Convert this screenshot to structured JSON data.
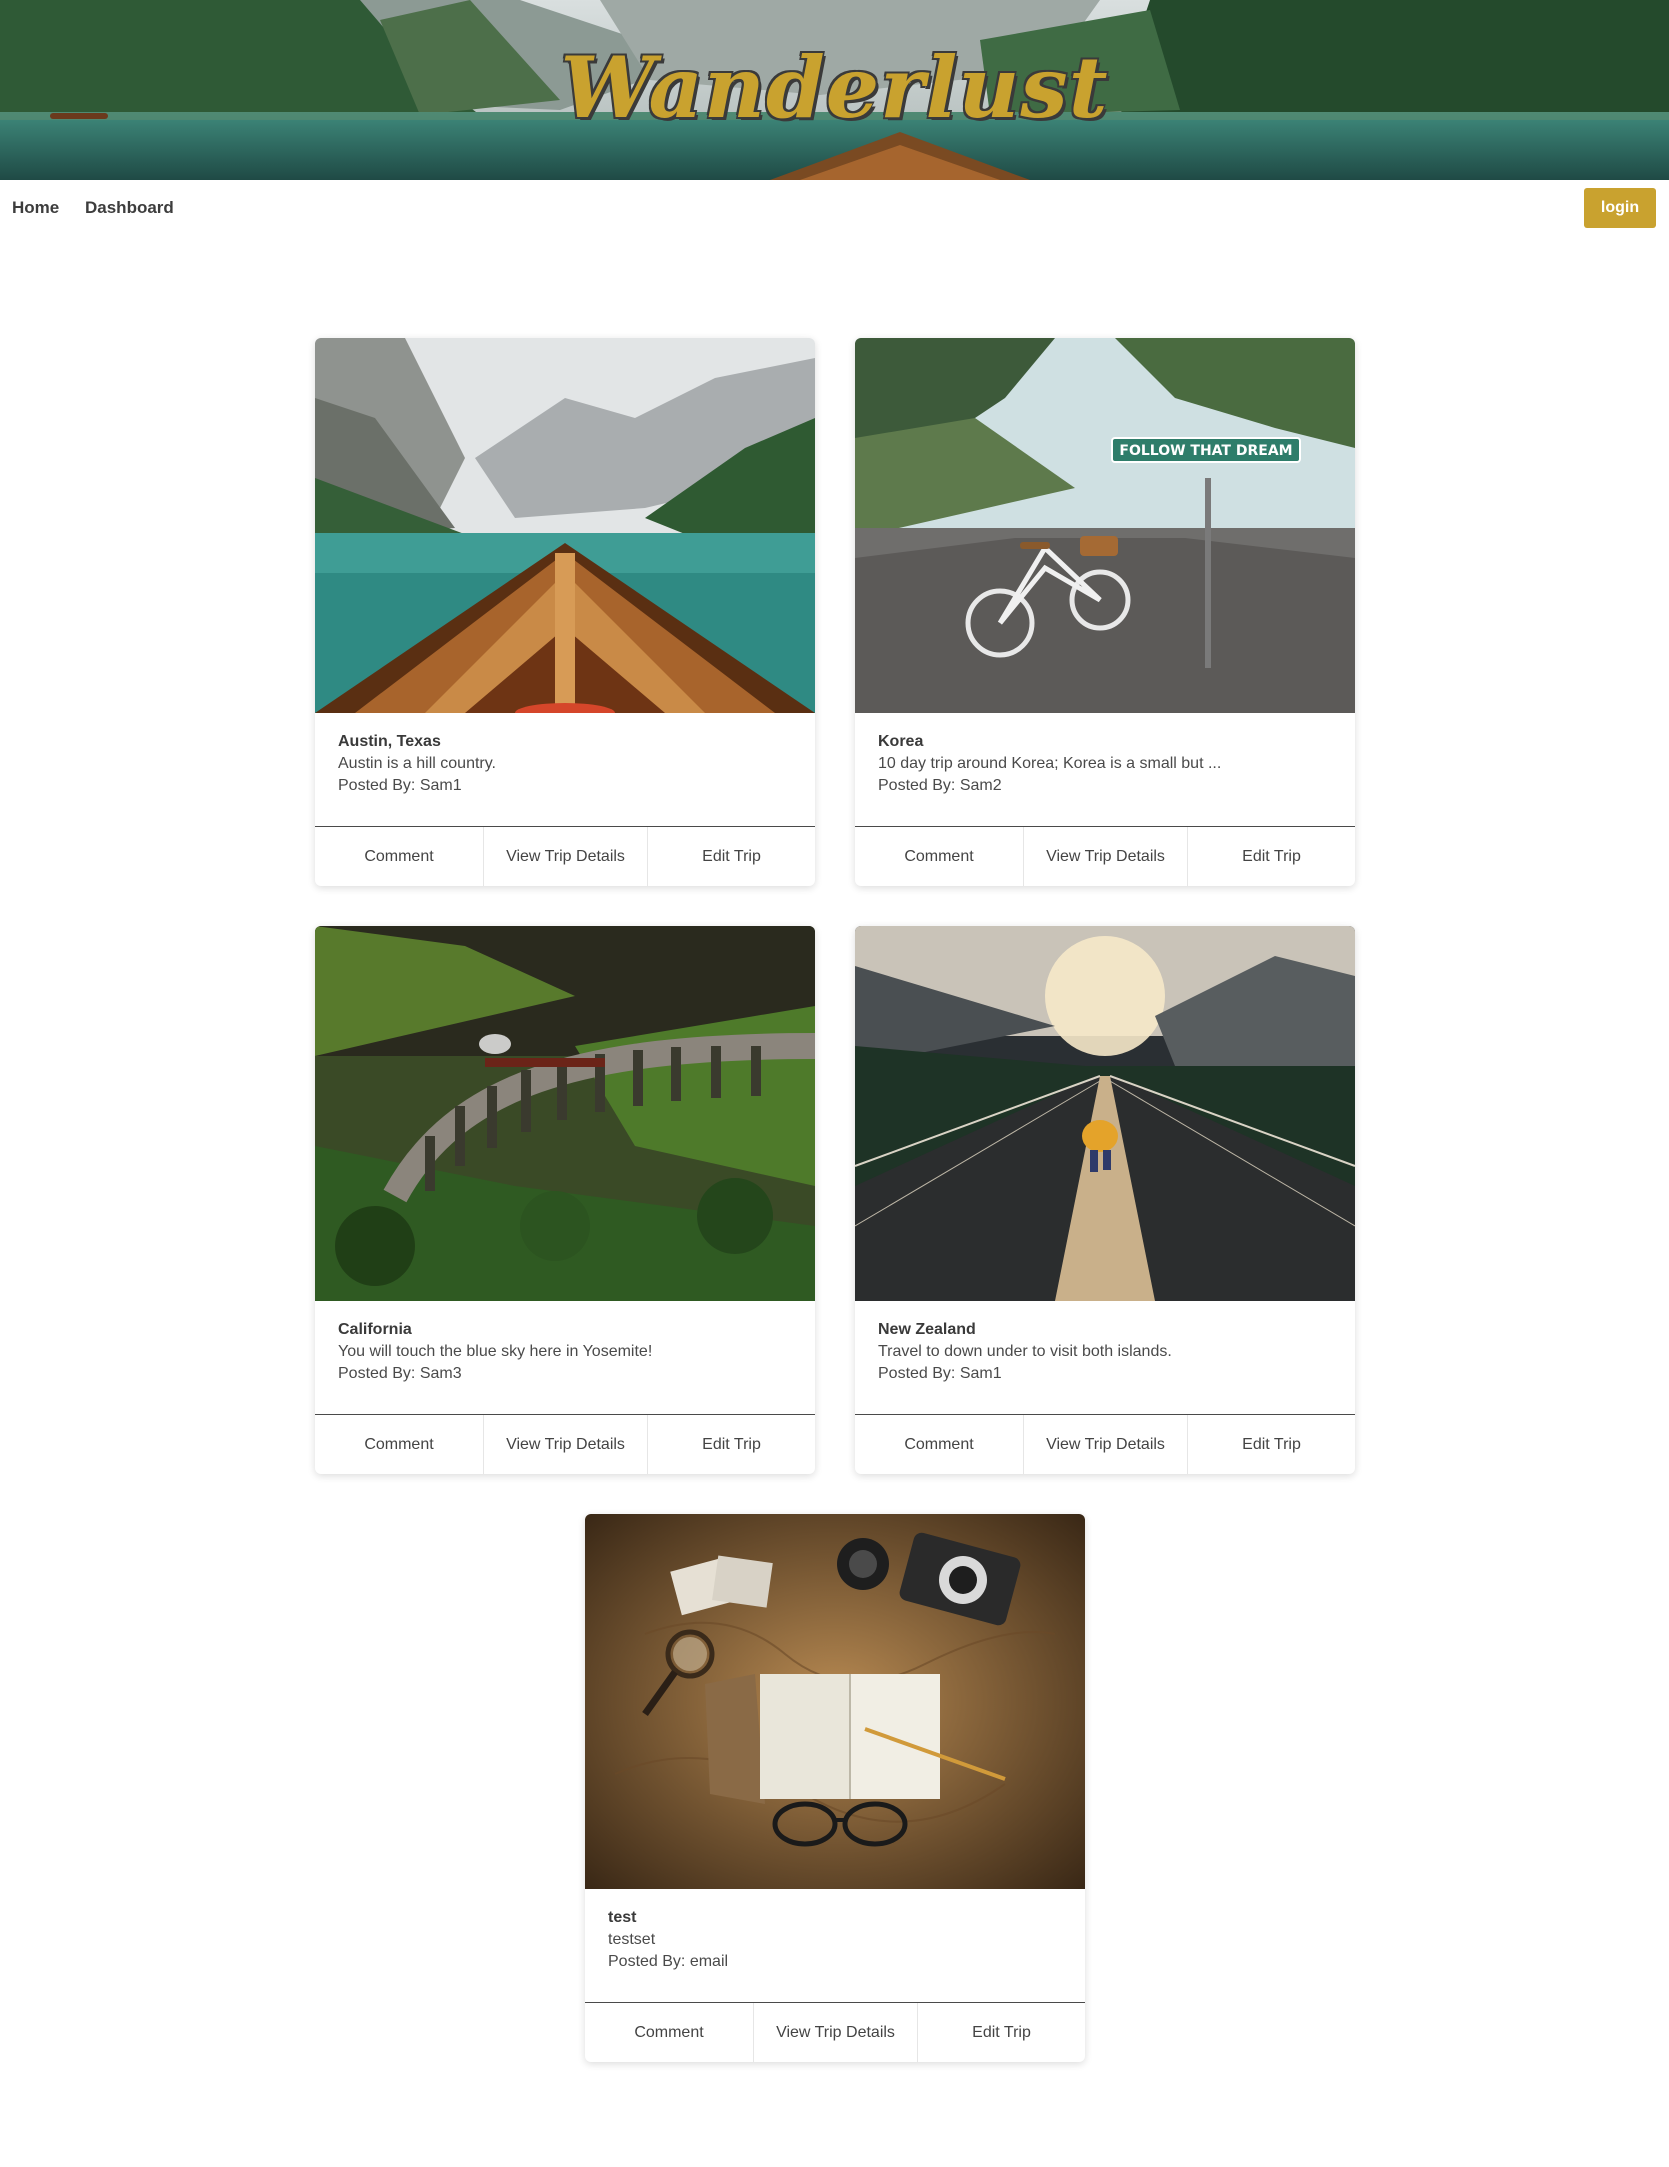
{
  "banner": {
    "brand": "Wanderlust"
  },
  "nav": {
    "home": "Home",
    "dashboard": "Dashboard",
    "login": "login"
  },
  "colors": {
    "accent": "#c9a22f",
    "text": "#3a3a3a"
  },
  "trips": [
    {
      "title": "Austin, Texas",
      "description": "Austin is a hill country.",
      "posted_by": "Posted By: Sam1",
      "image": "lake-boat-mountains"
    },
    {
      "title": "Korea",
      "description": "10 day trip around Korea; Korea is a small but ...",
      "posted_by": "Posted By: Sam2",
      "image": "bicycle-follow-that-dream",
      "sign_text": "FOLLOW THAT DREAM"
    },
    {
      "title": "California",
      "description": "You will touch the blue sky here in Yosemite!",
      "posted_by": "Posted By: Sam3",
      "image": "train-viaduct"
    },
    {
      "title": "New Zealand",
      "description": "Travel to down under to visit both islands.",
      "posted_by": "Posted By: Sam1",
      "image": "suspension-bridge-hiker"
    },
    {
      "title": "test",
      "description": "testset",
      "posted_by": "Posted By: email",
      "image": "map-camera-notebook"
    }
  ],
  "card_actions": {
    "comment": "Comment",
    "view": "View Trip Details",
    "edit": "Edit Trip"
  }
}
